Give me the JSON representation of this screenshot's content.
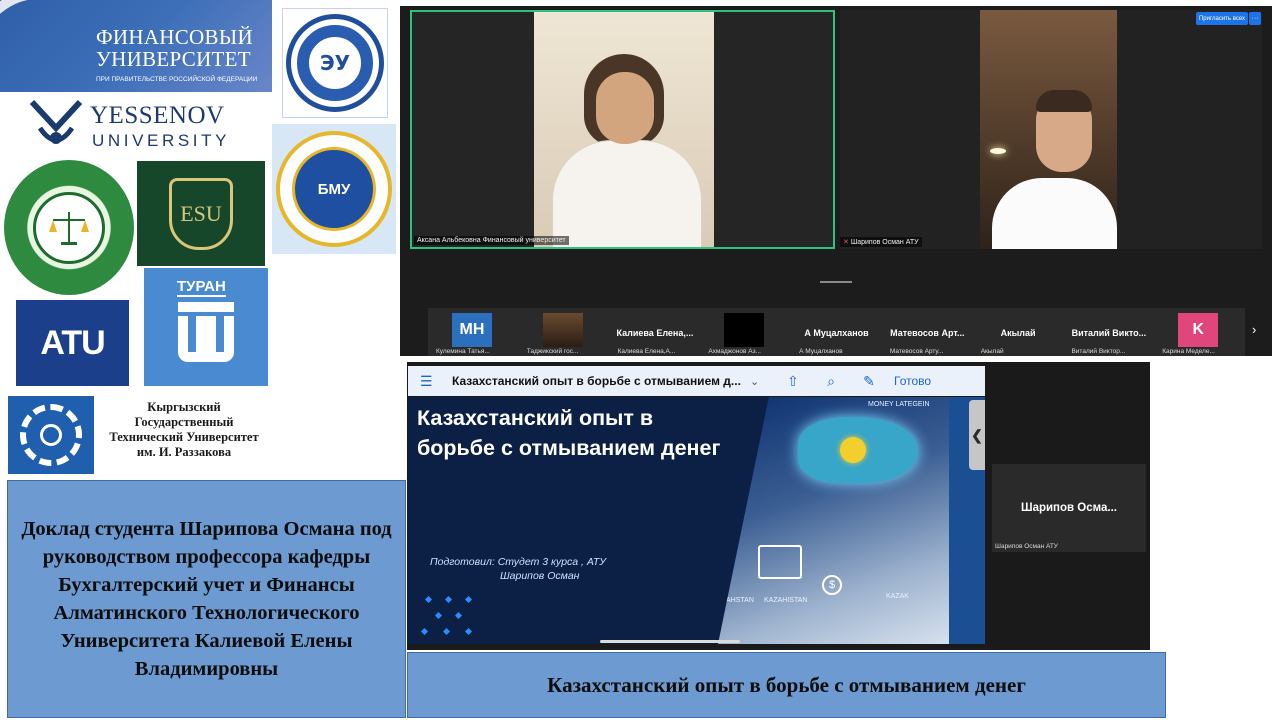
{
  "logos": {
    "financial_university": {
      "name_line1": "ФИНАНСОВЫЙ",
      "name_line2": "УНИВЕРСИТЕТ",
      "subtitle": "ПРИ ПРАВИТЕЛЬСТВЕ РОССИЙСКОЙ ФЕДЕРАЦИИ"
    },
    "belarus_economic": {
      "mark": "ЭУ"
    },
    "yessenov": {
      "line1": "YESSENOV",
      "line2": "UNIVERSITY"
    },
    "tajik_commerce": {
      "mark": ""
    },
    "esu": {
      "mark": "ESU"
    },
    "bishkek_state": {
      "mark": "БМУ"
    },
    "atu": {
      "mark": "ATU"
    },
    "turan": {
      "name": "ТУРАН"
    },
    "kgtu": {
      "text": "Кыргызский Государственный Технический Университет им. И. Раззакова"
    }
  },
  "report": {
    "text": "Доклад студента Шарипова Османа под руководством профессора кафедры Бухгалтерский учет и Финансы Алматинского Технологического Университета Калиевой Елены Владимировны"
  },
  "call": {
    "invite_label": "Пригласить всех",
    "more_label": "···",
    "participants_main": [
      {
        "label": "Аксана Альбековна Финансовый университет"
      },
      {
        "label": "Шарипов Осман АТУ"
      }
    ],
    "strip": [
      {
        "initials": "MH",
        "big": "",
        "caption": "Кулемина Татья...",
        "color": "#2b6fbf"
      },
      {
        "initials": "",
        "big": "",
        "caption": "Таджикский гос...",
        "color": "#3a2d22"
      },
      {
        "initials": "",
        "big": "Калиева Елена,...",
        "caption": "Калиева Елена,А...",
        "color": ""
      },
      {
        "initials": "",
        "big": "",
        "caption": "Ахмаджонов Аз...",
        "color": "#000000"
      },
      {
        "initials": "",
        "big": "А Муцалханов",
        "caption": "А Муцалханов",
        "color": ""
      },
      {
        "initials": "",
        "big": "Матевосов Арт...",
        "caption": "Матевосов Арту...",
        "color": ""
      },
      {
        "initials": "",
        "big": "Акылай",
        "caption": "Акылай",
        "color": ""
      },
      {
        "initials": "",
        "big": "Виталий Викто...",
        "caption": "Виталий Виктор...",
        "color": ""
      },
      {
        "initials": "K",
        "big": "",
        "caption": "Карина Меделе...",
        "color": "#e0457b"
      }
    ],
    "next_arrow": "›",
    "side_tile": {
      "name": "Шарипов Осма...",
      "caption": "Шарипов Осман АТУ"
    },
    "side_arrow": "❮"
  },
  "presentation": {
    "toolbar": {
      "list_icon": "☰",
      "title": "Казахстанский опыт в борьбе с отмыванием д...",
      "chevron": "⌄",
      "share_icon": "⇧",
      "search_icon": "⌕",
      "pen_icon": "✎",
      "done_label": "Готово"
    },
    "slide": {
      "title": "Казахстанский опыт в борьбе с отмыванием денег",
      "prepared_line1": "Подготовил: Студет 3 курса , АТУ",
      "prepared_line2": "Шарипов Осман",
      "art_labels": [
        "MONEY LATEGEIN",
        "AHSTAN",
        "KAZAHISTAN",
        "KAZAK"
      ]
    }
  },
  "caption": {
    "text": "Казахстанский опыт в борьбе с отмыванием денег"
  },
  "colors": {
    "panel_blue": "#6d9ad0",
    "slide_navy": "#0c1f45",
    "active_speaker": "#2ec27e"
  }
}
